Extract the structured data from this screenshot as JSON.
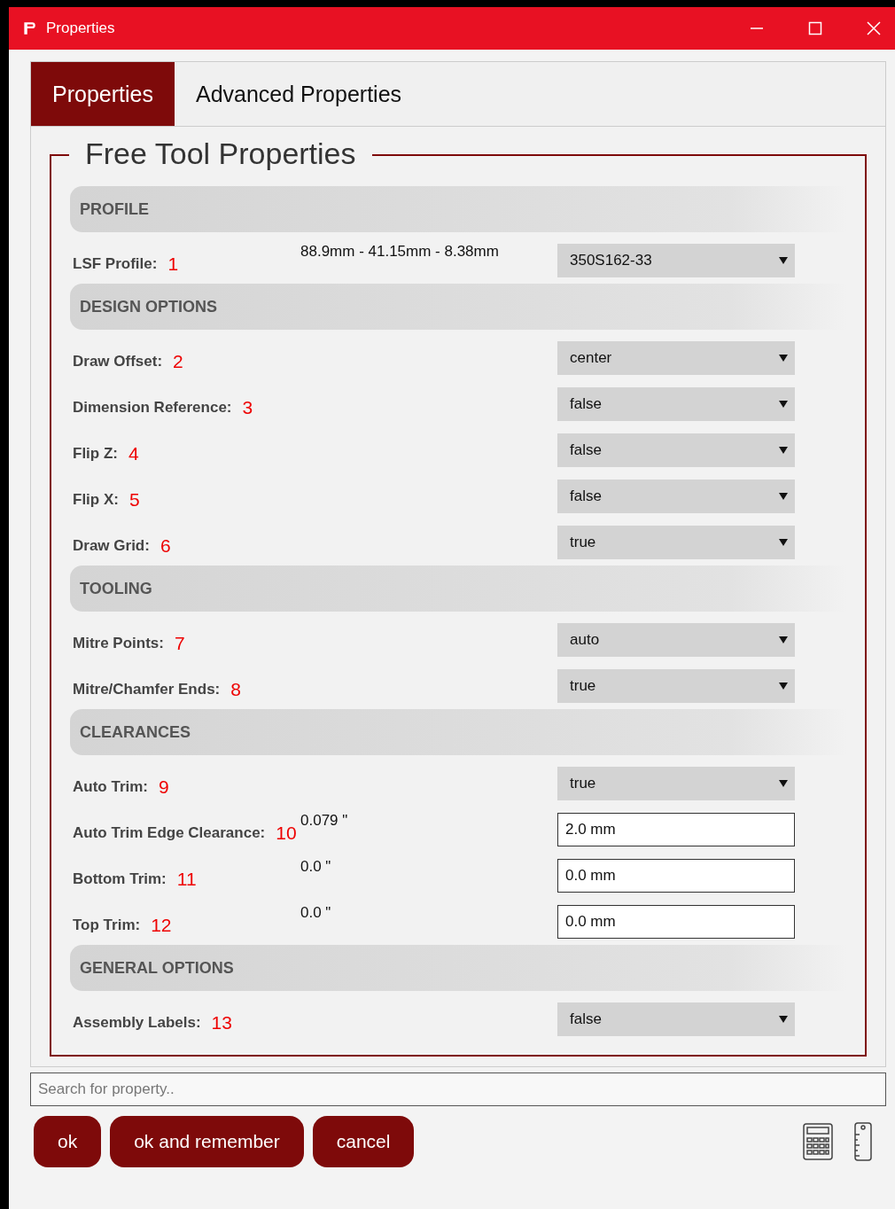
{
  "window": {
    "title": "Properties"
  },
  "tabs": [
    {
      "label": "Properties",
      "selected": true
    },
    {
      "label": "Advanced Properties",
      "selected": false
    }
  ],
  "panel": {
    "title": "Free Tool Properties",
    "sections": [
      {
        "title": "PROFILE",
        "rows": [
          {
            "label": "LSF Profile:",
            "marker": "1",
            "note": "88.9mm - 41.15mm - 8.38mm",
            "kind": "select",
            "value": "350S162-33"
          }
        ]
      },
      {
        "title": "DESIGN OPTIONS",
        "rows": [
          {
            "label": "Draw Offset:",
            "marker": "2",
            "kind": "select",
            "value": "center"
          },
          {
            "label": "Dimension Reference:",
            "marker": "3",
            "kind": "select",
            "value": "false"
          },
          {
            "label": "Flip Z:",
            "marker": "4",
            "kind": "select",
            "value": "false"
          },
          {
            "label": "Flip X:",
            "marker": "5",
            "kind": "select",
            "value": "false"
          },
          {
            "label": "Draw Grid:",
            "marker": "6",
            "kind": "select",
            "value": "true"
          }
        ]
      },
      {
        "title": "TOOLING",
        "rows": [
          {
            "label": "Mitre Points:",
            "marker": "7",
            "kind": "select",
            "value": "auto"
          },
          {
            "label": "Mitre/Chamfer Ends:",
            "marker": "8",
            "kind": "select",
            "value": "true"
          }
        ]
      },
      {
        "title": "CLEARANCES",
        "rows": [
          {
            "label": "Auto Trim:",
            "marker": "9",
            "kind": "select",
            "value": "true"
          },
          {
            "label": "Auto Trim Edge Clearance:",
            "marker": "10",
            "note": "0.079 \"",
            "kind": "input",
            "value": "2.0 mm"
          },
          {
            "label": "Bottom Trim:",
            "marker": "11",
            "note": "0.0 \"",
            "kind": "input",
            "value": "0.0 mm"
          },
          {
            "label": "Top Trim:",
            "marker": "12",
            "note": "0.0 \"",
            "kind": "input",
            "value": "0.0 mm"
          }
        ]
      },
      {
        "title": "GENERAL OPTIONS",
        "rows": [
          {
            "label": "Assembly Labels:",
            "marker": "13",
            "kind": "select",
            "value": "false"
          }
        ]
      }
    ]
  },
  "search": {
    "placeholder": "Search for property.."
  },
  "buttons": [
    "ok",
    "ok and remember",
    "cancel"
  ]
}
